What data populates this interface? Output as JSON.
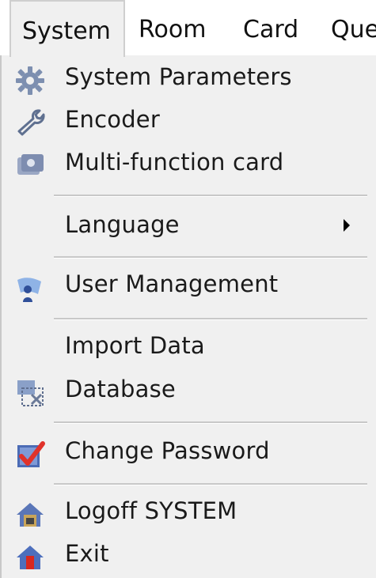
{
  "menubar": {
    "items": [
      {
        "label": "System"
      },
      {
        "label": "Room"
      },
      {
        "label": "Card"
      },
      {
        "label": "Que"
      }
    ]
  },
  "menu": {
    "system_parameters": {
      "label": "System Parameters",
      "icon": "gear-icon"
    },
    "encoder": {
      "label": "Encoder",
      "icon": "wrench-icon"
    },
    "multi_function_card": {
      "label": "Multi-function card",
      "icon": "cards-icon"
    },
    "language": {
      "label": "Language",
      "has_submenu": true
    },
    "user_management": {
      "label": "User Management",
      "icon": "user-icon"
    },
    "import_data": {
      "label": "Import Data"
    },
    "database": {
      "label": "Database",
      "icon": "database-icon"
    },
    "change_password": {
      "label": "Change Password",
      "icon": "checkmark-icon"
    },
    "logoff_system": {
      "label": "Logoff SYSTEM",
      "icon": "house-lock-icon"
    },
    "exit": {
      "label": "Exit",
      "icon": "house-exit-icon"
    }
  },
  "colors": {
    "menu_background": "#f0f0f0",
    "menubar_background": "#ffffff",
    "separator": "#c8c8c8",
    "text": "#1a1a1a"
  }
}
